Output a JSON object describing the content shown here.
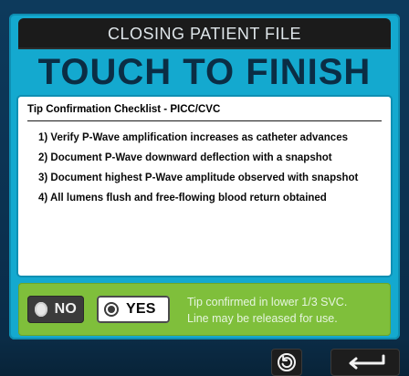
{
  "header": {
    "title": "CLOSING PATIENT FILE",
    "big_text": "TOUCH TO FINISH"
  },
  "checklist": {
    "title": "Tip Confirmation Checklist - PICC/CVC",
    "items": [
      "1) Verify P-Wave amplification increases as catheter advances",
      "2) Document P-Wave downward deflection with a snapshot",
      "3) Document highest P-Wave amplitude observed with snapshot",
      "4) All lumens flush and free-flowing blood return obtained"
    ]
  },
  "confirmation": {
    "no_label": "NO",
    "yes_label": "YES",
    "selected": "YES",
    "message_lines": [
      "Tip confirmed in lower 1/3 SVC.",
      "Line may be released for use."
    ]
  },
  "icons": {
    "undo": "undo-icon",
    "enter": "enter-icon"
  },
  "colors": {
    "panel_blue": "#14a9cf",
    "header_dark": "#1b1b1b",
    "big_text_navy": "#0b2d44",
    "green_bar": "#7fbf3b"
  }
}
